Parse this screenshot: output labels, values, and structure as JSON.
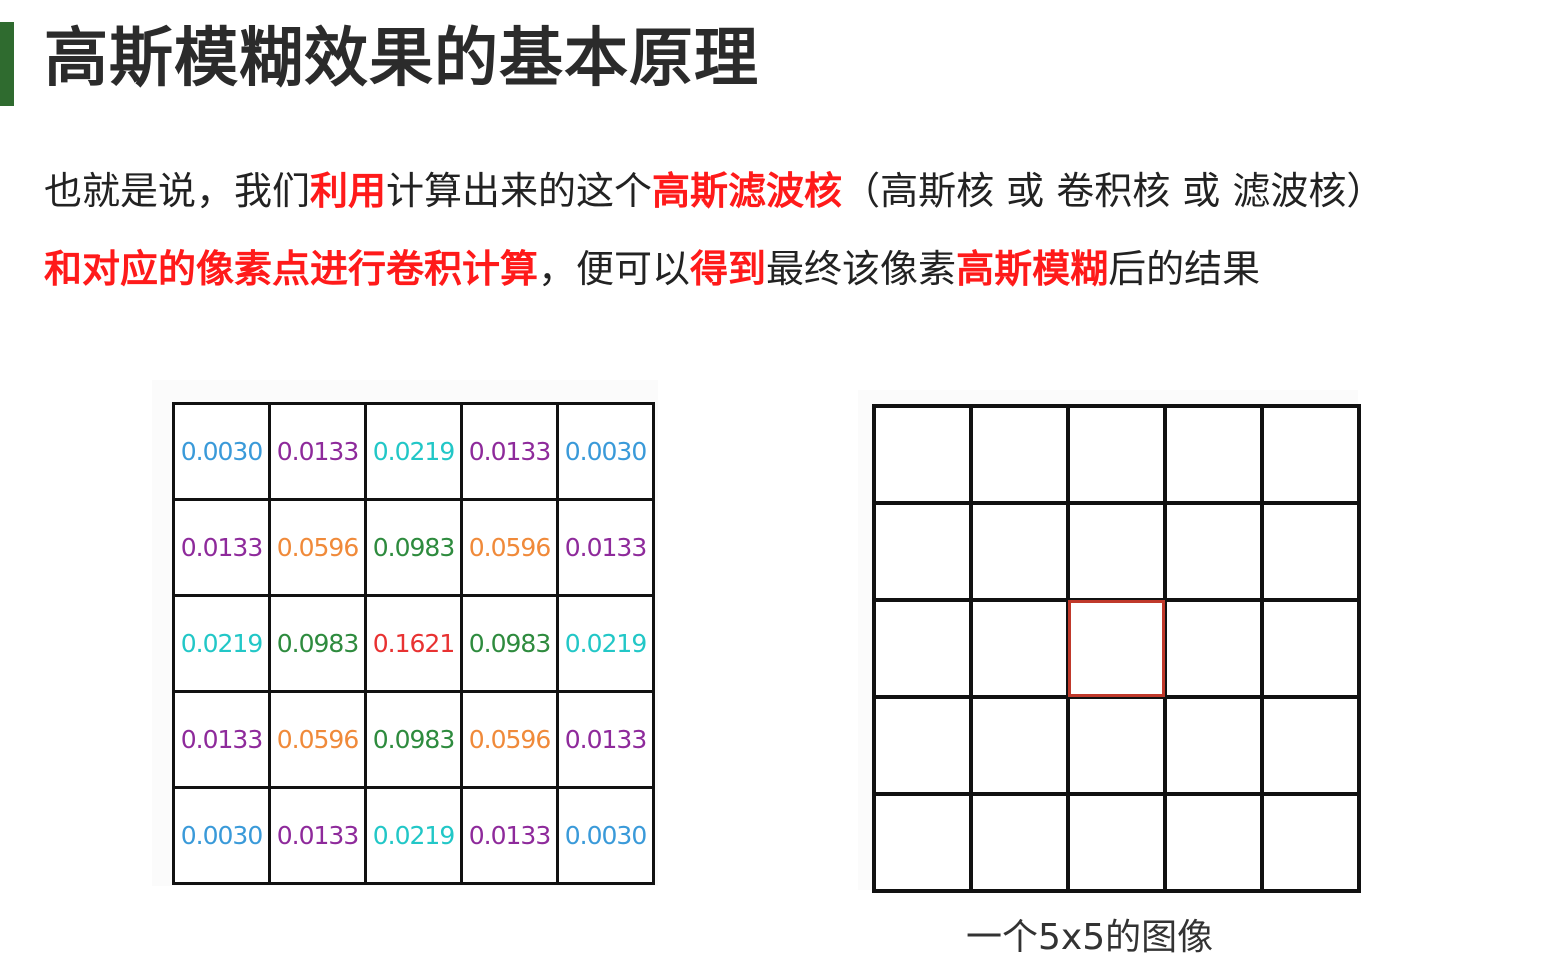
{
  "title": "高斯模糊效果的基本原理",
  "paragraph": {
    "line1": [
      {
        "text": "也就是说，我们",
        "hl": false
      },
      {
        "text": "利用",
        "hl": true
      },
      {
        "text": "计算出来的这个",
        "hl": false
      },
      {
        "text": "高斯滤波核",
        "hl": true
      },
      {
        "text": "（高斯核 或 卷积核 或 滤波核）",
        "hl": false
      }
    ],
    "line2": [
      {
        "text": "和对应的像素点进行卷积计算",
        "hl": true
      },
      {
        "text": "，便可以",
        "hl": false
      },
      {
        "text": "得到",
        "hl": true
      },
      {
        "text": "最终该像素",
        "hl": false
      },
      {
        "text": "高斯模糊",
        "hl": true
      },
      {
        "text": "后的结果",
        "hl": false
      }
    ]
  },
  "kernel": {
    "rows": [
      [
        "0.0030",
        "0.0133",
        "0.0219",
        "0.0133",
        "0.0030"
      ],
      [
        "0.0133",
        "0.0596",
        "0.0983",
        "0.0596",
        "0.0133"
      ],
      [
        "0.0219",
        "0.0983",
        "0.1621",
        "0.0983",
        "0.0219"
      ],
      [
        "0.0133",
        "0.0596",
        "0.0983",
        "0.0596",
        "0.0133"
      ],
      [
        "0.0030",
        "0.0133",
        "0.0219",
        "0.0133",
        "0.0030"
      ]
    ],
    "value_colors": {
      "0.0030": "#3a9ad9",
      "0.0133": "#8e2a9b",
      "0.0219": "#22c7c7",
      "0.0596": "#f08a3a",
      "0.0983": "#2e8b3e",
      "0.1621": "#e83232"
    }
  },
  "image_grid": {
    "size": 5,
    "highlight_row": 2,
    "highlight_col": 2,
    "highlight_color": "#c0392b"
  },
  "caption": "一个5x5的图像"
}
